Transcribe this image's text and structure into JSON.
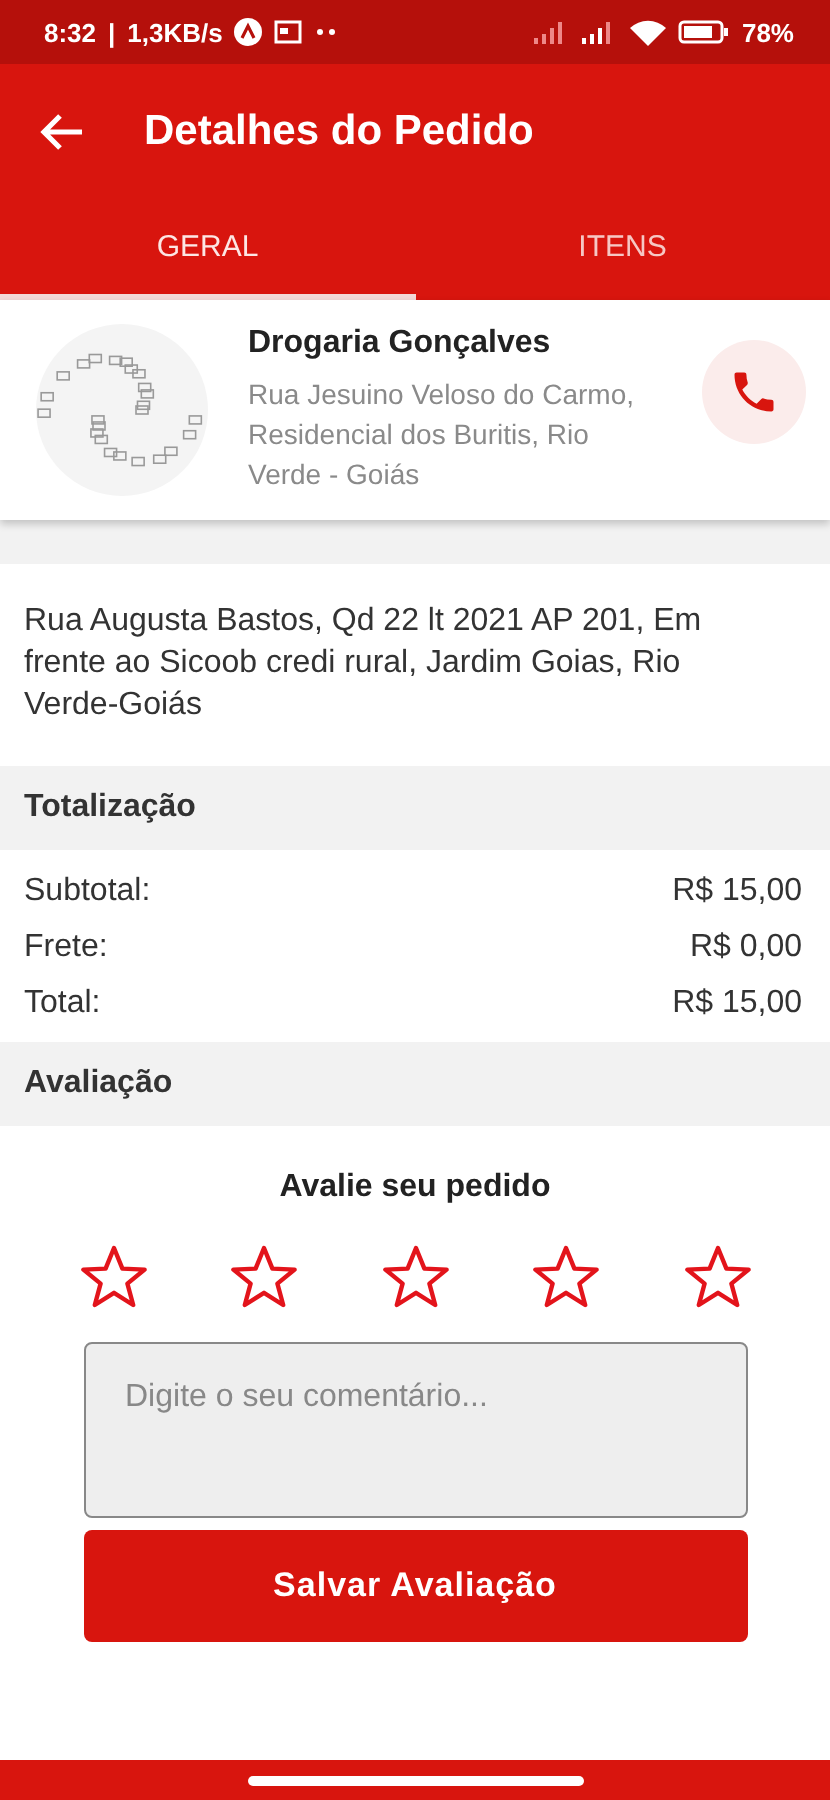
{
  "status_bar": {
    "time": "8:32",
    "separator": "|",
    "network_speed": "1,3KB/s",
    "battery": "78%"
  },
  "app_bar": {
    "title": "Detalhes do Pedido"
  },
  "tabs": [
    {
      "label": "GERAL",
      "selected": true
    },
    {
      "label": "ITENS",
      "selected": false
    }
  ],
  "store": {
    "name": "Drogaria Gonçalves",
    "address": "Rua Jesuino Veloso do Carmo, Residencial dos Buritis, Rio Verde - Goiás"
  },
  "delivery": {
    "address": "Rua Augusta Bastos, Qd 22 lt 2021 AP 201, Em frente ao Sicoob credi rural, Jardim Goias, Rio Verde-Goiás"
  },
  "totals": {
    "title": "Totalização",
    "rows": [
      {
        "label": "Subtotal:",
        "value": "R$ 15,00"
      },
      {
        "label": "Frete:",
        "value": "R$ 0,00"
      },
      {
        "label": "Total:",
        "value": "R$ 15,00"
      }
    ]
  },
  "rating": {
    "section_title": "Avaliação",
    "prompt": "Avalie seu pedido",
    "stars": 0,
    "comment_placeholder": "Digite o seu comentário...",
    "button": "Salvar Avaliação"
  }
}
